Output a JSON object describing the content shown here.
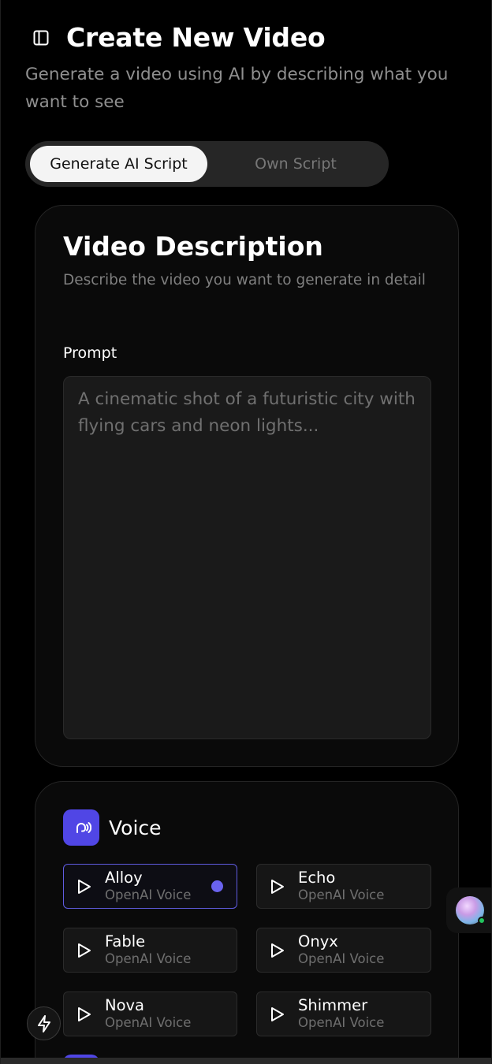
{
  "header": {
    "title": "Create New Video",
    "subtitle": "Generate a video using AI by describing what you want to see"
  },
  "tabs": [
    {
      "label": "Generate AI Script",
      "active": true
    },
    {
      "label": "Own Script",
      "active": false
    }
  ],
  "description_card": {
    "title": "Video Description",
    "subtitle": "Describe the video you want to generate in detail",
    "prompt_label": "Prompt",
    "prompt_placeholder": "A cinematic shot of a futuristic city with flying cars and neon lights..."
  },
  "voice_card": {
    "title": "Voice",
    "options": [
      {
        "name": "Alloy",
        "provider": "OpenAI Voice",
        "selected": true
      },
      {
        "name": "Echo",
        "provider": "OpenAI Voice",
        "selected": false
      },
      {
        "name": "Fable",
        "provider": "OpenAI Voice",
        "selected": false
      },
      {
        "name": "Onyx",
        "provider": "OpenAI Voice",
        "selected": false
      },
      {
        "name": "Nova",
        "provider": "OpenAI Voice",
        "selected": false
      },
      {
        "name": "Shimmer",
        "provider": "OpenAI Voice",
        "selected": false
      }
    ]
  },
  "icons": {
    "sidebar_toggle": "sidebar-toggle-icon",
    "voice": "voice-wave-icon",
    "play": "play-icon",
    "bolt": "lightning-bolt-icon",
    "avatar": "user-avatar"
  },
  "colors": {
    "accent": "#5046e5",
    "selected_border": "#5f5be0",
    "status_online": "#22c55e"
  }
}
